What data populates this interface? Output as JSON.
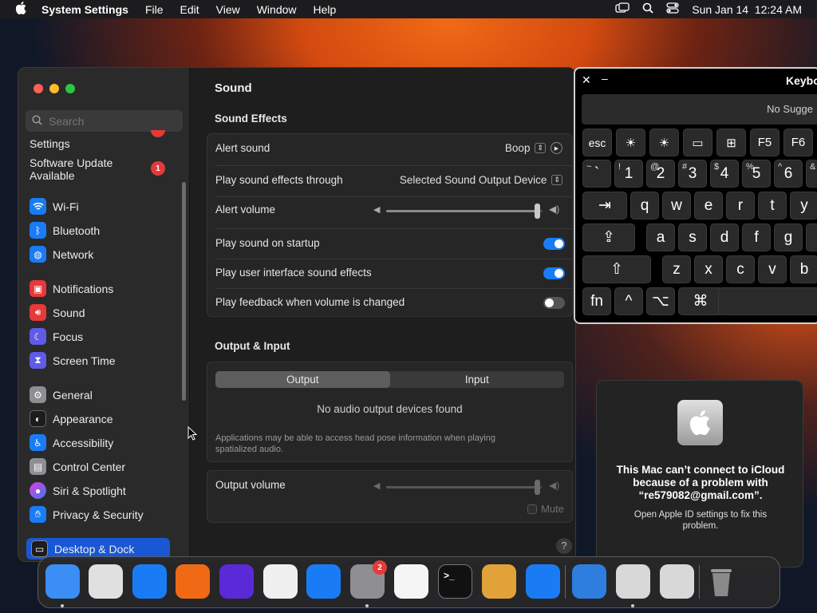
{
  "menubar": {
    "app": "System Settings",
    "items": [
      "File",
      "Edit",
      "View",
      "Window",
      "Help"
    ],
    "clock": "Sun Jan 14  12:24 AM"
  },
  "sidebar": {
    "search_placeholder": "Search",
    "items": [
      {
        "label": "Settings"
      },
      {
        "label": "Software Update\nAvailable",
        "badge": "1"
      },
      {
        "label": "Wi-Fi",
        "icon": "wifi-icon",
        "color": "#1a7cf5"
      },
      {
        "label": "Bluetooth",
        "icon": "bluetooth-icon",
        "color": "#1a7cf5"
      },
      {
        "label": "Network",
        "icon": "globe-icon",
        "color": "#1a7cf5"
      },
      {
        "label": "Notifications",
        "icon": "bell-icon",
        "color": "#e5393a"
      },
      {
        "label": "Sound",
        "icon": "speaker-icon",
        "color": "#e5393a"
      },
      {
        "label": "Focus",
        "icon": "moon-icon",
        "color": "#5e5ce6"
      },
      {
        "label": "Screen Time",
        "icon": "hourglass-icon",
        "color": "#5e5ce6"
      },
      {
        "label": "General",
        "icon": "gear-icon",
        "color": "#8e8e93"
      },
      {
        "label": "Appearance",
        "icon": "appearance-icon",
        "color": "#1c1c1e"
      },
      {
        "label": "Accessibility",
        "icon": "accessibility-icon",
        "color": "#1a7cf5"
      },
      {
        "label": "Control Center",
        "icon": "control-center-icon",
        "color": "#8e8e93"
      },
      {
        "label": "Siri & Spotlight",
        "icon": "siri-icon",
        "color": "#a23bd8"
      },
      {
        "label": "Privacy & Security",
        "icon": "hand-icon",
        "color": "#1a7cf5"
      },
      {
        "label": "Desktop & Dock",
        "icon": "dock-icon",
        "color": "#1c1c1e"
      }
    ]
  },
  "main": {
    "title": "Sound",
    "effects": {
      "heading": "Sound Effects",
      "alert_sound_label": "Alert sound",
      "alert_sound_value": "Boop",
      "output_through_label": "Play sound effects through",
      "output_through_value": "Selected Sound Output Device",
      "alert_volume_label": "Alert volume",
      "alert_volume_level": 0.97,
      "startup_label": "Play sound on startup",
      "startup_on": true,
      "ui_sounds_label": "Play user interface sound effects",
      "ui_sounds_on": true,
      "feedback_label": "Play feedback when volume is changed",
      "feedback_on": false
    },
    "output_input": {
      "heading": "Output & Input",
      "tab_output": "Output",
      "tab_input": "Input",
      "empty": "No audio output devices found",
      "note": "Applications may be able to access head pose information when playing spatialized audio.",
      "volume_label": "Output volume",
      "volume_level": 0.97,
      "mute_label": "Mute"
    },
    "help": "?"
  },
  "keyboard": {
    "title": "Keybo",
    "suggestions": "No Sugge",
    "row0": [
      "esc",
      "☀",
      "☀",
      "▭",
      "⊞",
      "F5",
      "F6"
    ],
    "row1": [
      {
        "top": "~",
        "mid": "`"
      },
      {
        "top": "!",
        "mid": "1"
      },
      {
        "top": "@",
        "mid": "2"
      },
      {
        "top": "#",
        "mid": "3"
      },
      {
        "top": "$",
        "mid": "4"
      },
      {
        "top": "%",
        "mid": "5"
      },
      {
        "top": "^",
        "mid": "6"
      },
      {
        "top": "&",
        "mid": ""
      }
    ],
    "row2": [
      "⇥",
      "q",
      "w",
      "e",
      "r",
      "t",
      "y"
    ],
    "row3": [
      "⇪",
      "a",
      "s",
      "d",
      "f",
      "g",
      "h"
    ],
    "row4": [
      "⇧",
      "z",
      "x",
      "c",
      "v",
      "b"
    ],
    "row5": [
      "fn",
      "^",
      "⌥",
      "⌘"
    ]
  },
  "icloud_dialog": {
    "title": "This Mac can’t connect to iCloud because of a problem with “re579082@gmail.com”.",
    "message": "Open Apple ID settings to fix this problem."
  },
  "dock": {
    "apps": [
      {
        "name": "Finder",
        "color": "#3a8ef5"
      },
      {
        "name": "Launchpad",
        "color": "#e0e0e0"
      },
      {
        "name": "Safari",
        "color": "#1a7cf5"
      },
      {
        "name": "Firefox",
        "color": "#f06a16"
      },
      {
        "name": "Fenix",
        "color": "#5a2ad8"
      },
      {
        "name": "Chrome",
        "color": "#f0f0f0"
      },
      {
        "name": "App Store",
        "color": "#1a7cf5"
      },
      {
        "name": "System Settings",
        "color": "#8e8e93",
        "badge": "2"
      },
      {
        "name": "TextEdit",
        "color": "#f5f5f5"
      },
      {
        "name": "Terminal",
        "color": "#111111"
      },
      {
        "name": "GarageBand",
        "color": "#e2a23a"
      },
      {
        "name": "VS Code",
        "color": "#1a7cf5"
      },
      {
        "name": "Weather",
        "color": "#2e7ee0"
      },
      {
        "name": "Migration Assistant",
        "color": "#d8d8d8"
      },
      {
        "name": "Disk Utility",
        "color": "#d8d8d8"
      },
      {
        "name": "Trash",
        "color": "#777777"
      }
    ]
  }
}
